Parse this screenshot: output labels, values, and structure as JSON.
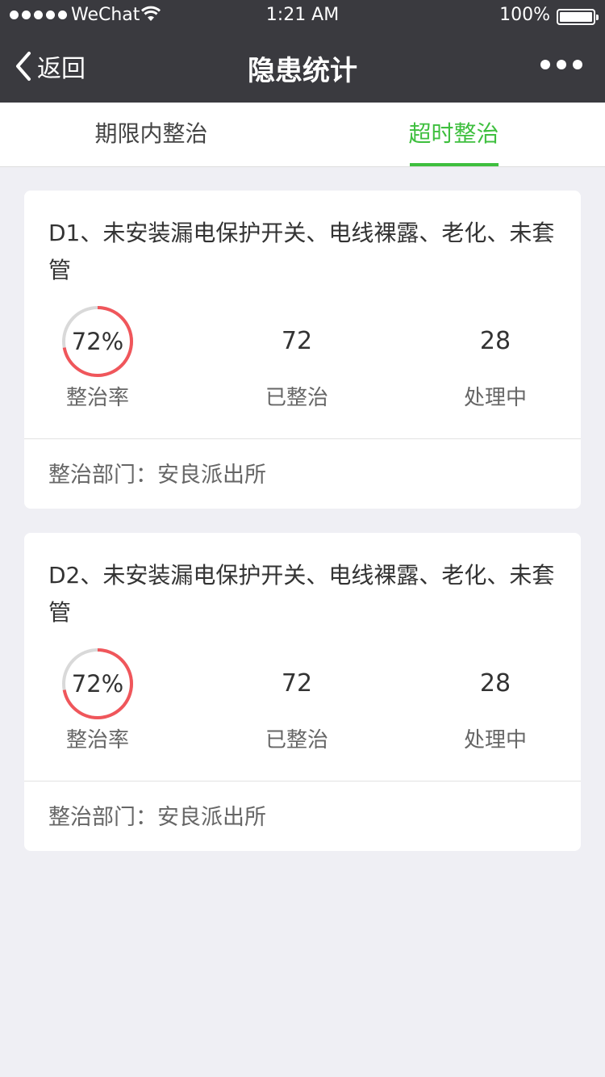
{
  "status": {
    "carrier": "WeChat",
    "time": "1:21 AM",
    "battery": "100%"
  },
  "nav": {
    "back_label": "返回",
    "title": "隐患统计"
  },
  "tabs": [
    {
      "label": "期限内整治",
      "active": false
    },
    {
      "label": "超时整治",
      "active": true
    }
  ],
  "colors": {
    "accent": "#3ebf3e",
    "ring_progress": "#f0565b",
    "ring_track": "#d9d9d9",
    "header_bg": "#3a3a3f"
  },
  "cards": [
    {
      "title": "D1、未安装漏电保护开关、电线裸露、老化、未套管",
      "rate_text": "72%",
      "rate_value": 0.72,
      "rate_label": "整治率",
      "done": "72",
      "done_label": "已整治",
      "pending": "28",
      "pending_label": "处理中",
      "dept": "整治部门：安良派出所"
    },
    {
      "title": "D2、未安装漏电保护开关、电线裸露、老化、未套管",
      "rate_text": "72%",
      "rate_value": 0.72,
      "rate_label": "整治率",
      "done": "72",
      "done_label": "已整治",
      "pending": "28",
      "pending_label": "处理中",
      "dept": "整治部门：安良派出所"
    }
  ]
}
